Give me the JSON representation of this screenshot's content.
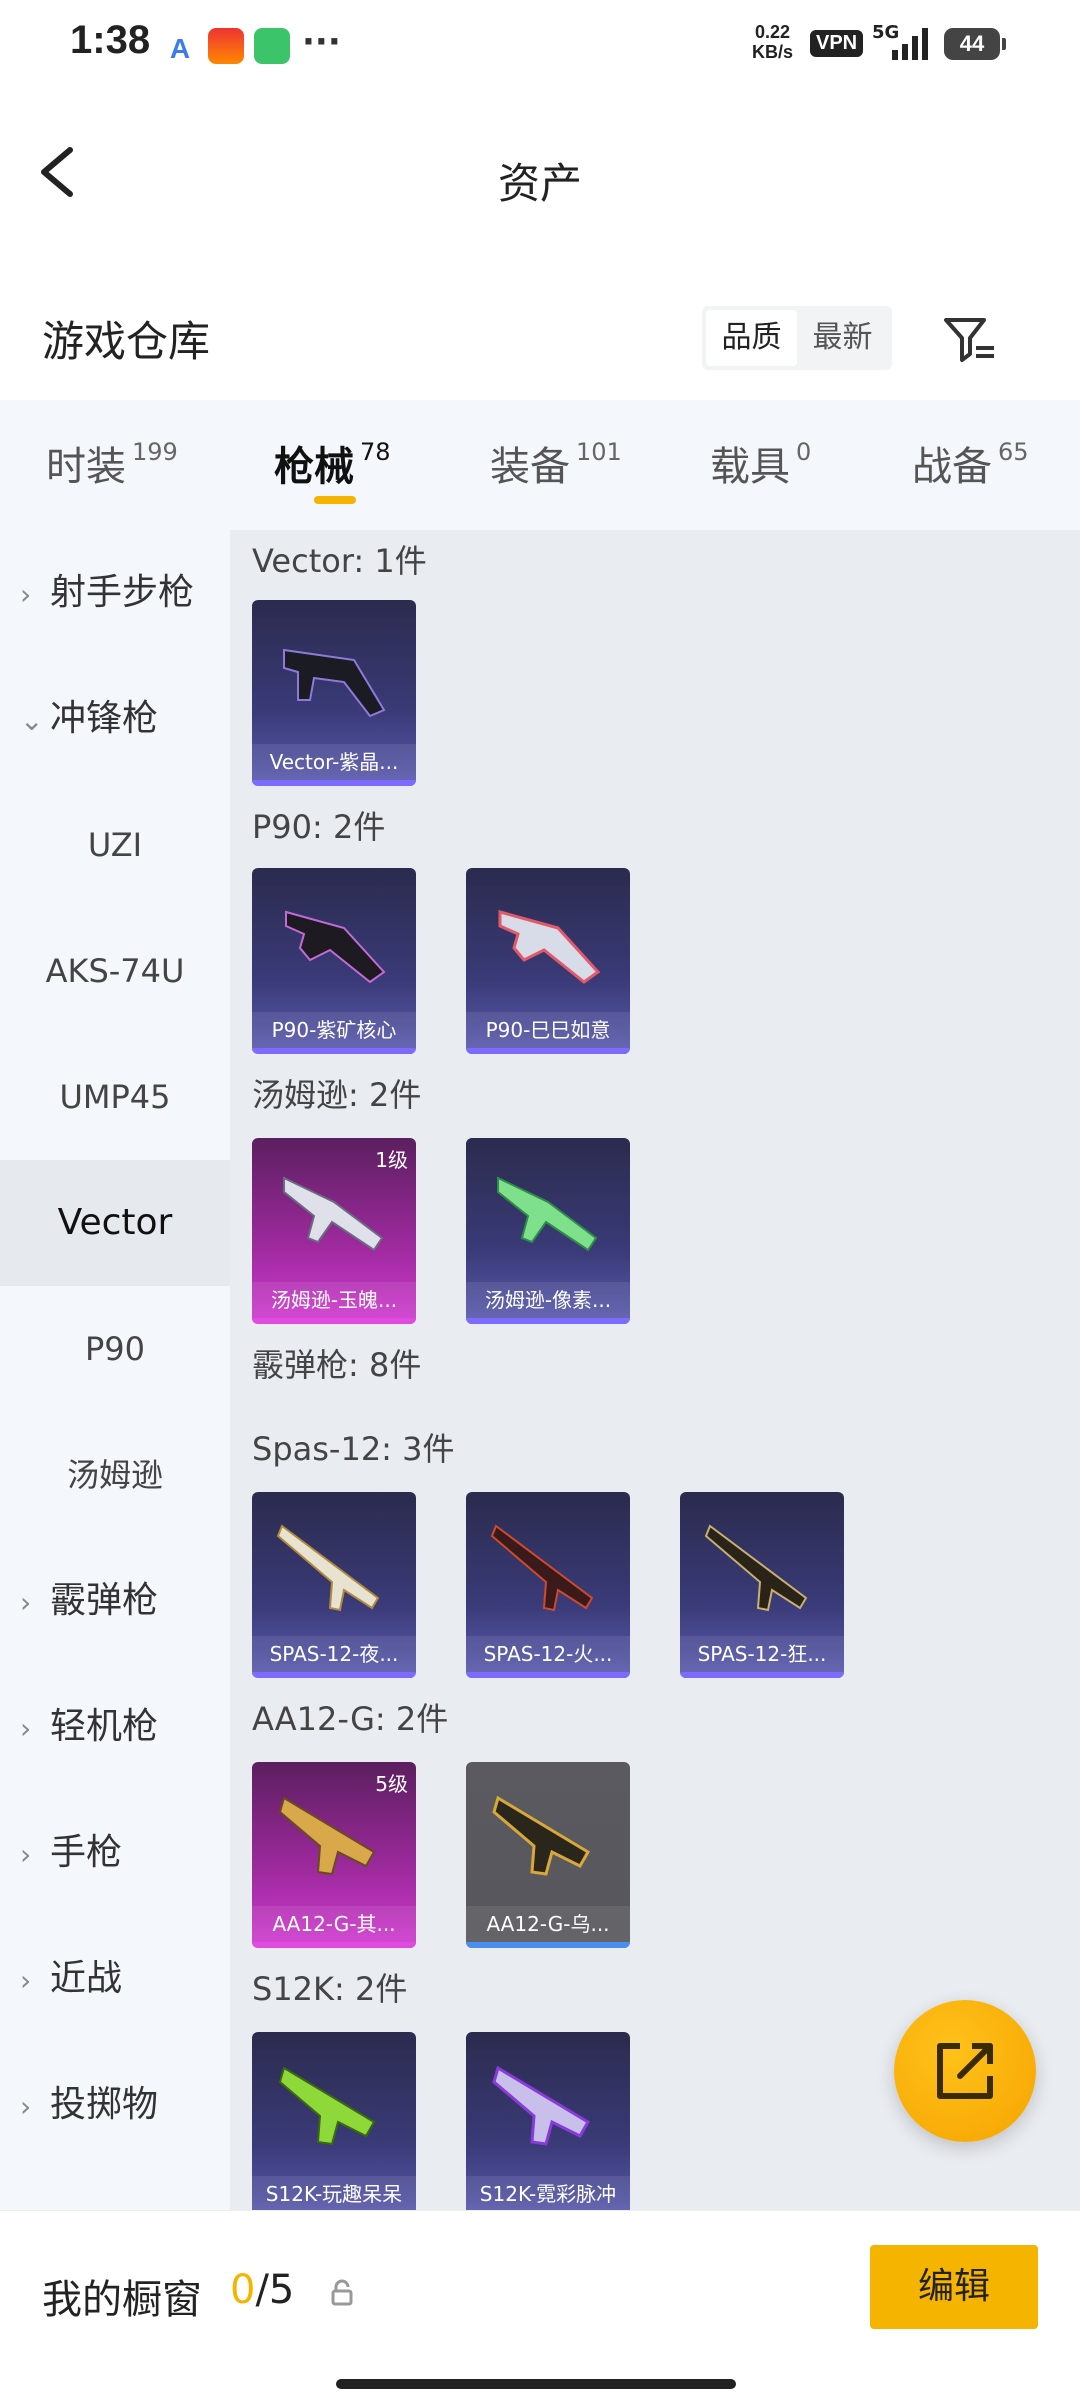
{
  "status_bar": {
    "time": "1:38",
    "net_speed_value": "0.22",
    "net_speed_unit": "KB/s",
    "vpn": "VPN",
    "network": "5G",
    "battery": "44"
  },
  "header": {
    "title": "资产"
  },
  "warehouse": {
    "title": "游戏仓库",
    "sort_options": [
      "品质",
      "最新"
    ],
    "active_sort": "品质"
  },
  "tabs": [
    {
      "label": "时装",
      "count": "199"
    },
    {
      "label": "枪械",
      "count": "78"
    },
    {
      "label": "装备",
      "count": "101"
    },
    {
      "label": "载具",
      "count": "0"
    },
    {
      "label": "战备",
      "count": "65"
    }
  ],
  "active_tab": "枪械",
  "sidebar": [
    {
      "label": "射手步枪",
      "type": "category",
      "expanded": false
    },
    {
      "label": "冲锋枪",
      "type": "category",
      "expanded": true
    },
    {
      "label": "UZI",
      "type": "sub"
    },
    {
      "label": "AKS-74U",
      "type": "sub"
    },
    {
      "label": "UMP45",
      "type": "sub"
    },
    {
      "label": "Vector",
      "type": "sub",
      "active": true
    },
    {
      "label": "P90",
      "type": "sub"
    },
    {
      "label": "汤姆逊",
      "type": "sub"
    },
    {
      "label": "霰弹枪",
      "type": "category",
      "expanded": false
    },
    {
      "label": "轻机枪",
      "type": "category",
      "expanded": false
    },
    {
      "label": "手枪",
      "type": "category",
      "expanded": false
    },
    {
      "label": "近战",
      "type": "category",
      "expanded": false
    },
    {
      "label": "投掷物",
      "type": "category",
      "expanded": false
    }
  ],
  "groups": [
    {
      "title": "Vector: 1件",
      "items": [
        {
          "label": "Vector-紫晶...",
          "level": "",
          "rarity": "purple"
        }
      ]
    },
    {
      "title": "P90: 2件",
      "items": [
        {
          "label": "P90-紫矿核心",
          "level": "",
          "rarity": "purple"
        },
        {
          "label": "P90-巳巳如意",
          "level": "",
          "rarity": "purple"
        }
      ]
    },
    {
      "title": "汤姆逊: 2件",
      "items": [
        {
          "label": "汤姆逊-玉魄...",
          "level": "1级",
          "rarity": "pink"
        },
        {
          "label": "汤姆逊-像素...",
          "level": "",
          "rarity": "purple"
        }
      ]
    },
    {
      "title": "霰弹枪: 8件",
      "items": []
    },
    {
      "title": "Spas-12: 3件",
      "items": [
        {
          "label": "SPAS-12-夜...",
          "level": "",
          "rarity": "purple"
        },
        {
          "label": "SPAS-12-火...",
          "level": "",
          "rarity": "purple"
        },
        {
          "label": "SPAS-12-狂...",
          "level": "",
          "rarity": "purple"
        }
      ]
    },
    {
      "title": "AA12-G: 2件",
      "items": [
        {
          "label": "AA12-G-其...",
          "level": "5级",
          "rarity": "pink"
        },
        {
          "label": "AA12-G-乌...",
          "level": "",
          "rarity": "gray"
        }
      ]
    },
    {
      "title": "S12K: 2件",
      "items": [
        {
          "label": "S12K-玩趣呆呆",
          "level": "",
          "rarity": "purple"
        },
        {
          "label": "S12K-霓彩脉冲",
          "level": "",
          "rarity": "purple"
        }
      ]
    }
  ],
  "showcase": {
    "title": "我的橱窗",
    "used": "0",
    "total": "/5",
    "edit_label": "编辑"
  },
  "colors": {
    "accent": "#f5b400",
    "purple_card": "#3a3a78",
    "pink_card": "#a02aa0",
    "gray_card": "#56565c"
  }
}
